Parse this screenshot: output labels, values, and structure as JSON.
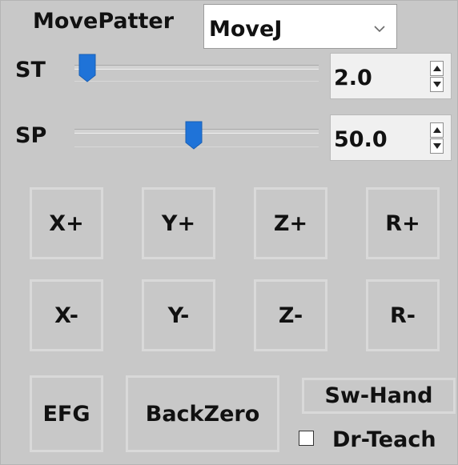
{
  "move_pattern": {
    "label": "MovePatter",
    "selected": "MoveJ"
  },
  "st": {
    "label": "ST",
    "value": "2.0"
  },
  "sp": {
    "label": "SP",
    "value": "50.0"
  },
  "jog_buttons": {
    "row1": [
      "X+",
      "Y+",
      "Z+",
      "R+"
    ],
    "row2": [
      "X-",
      "Y-",
      "Z-",
      "R-"
    ]
  },
  "actions": {
    "efg": "EFG",
    "back_zero": "BackZero",
    "sw_hand": "Sw-Hand",
    "dr_teach": "Dr-Teach"
  },
  "dr_teach_checked": false,
  "colors": {
    "panel_bg": "#c8c8c8",
    "slider_thumb": "#1f73d8",
    "button_border": "#d9d9d9"
  }
}
